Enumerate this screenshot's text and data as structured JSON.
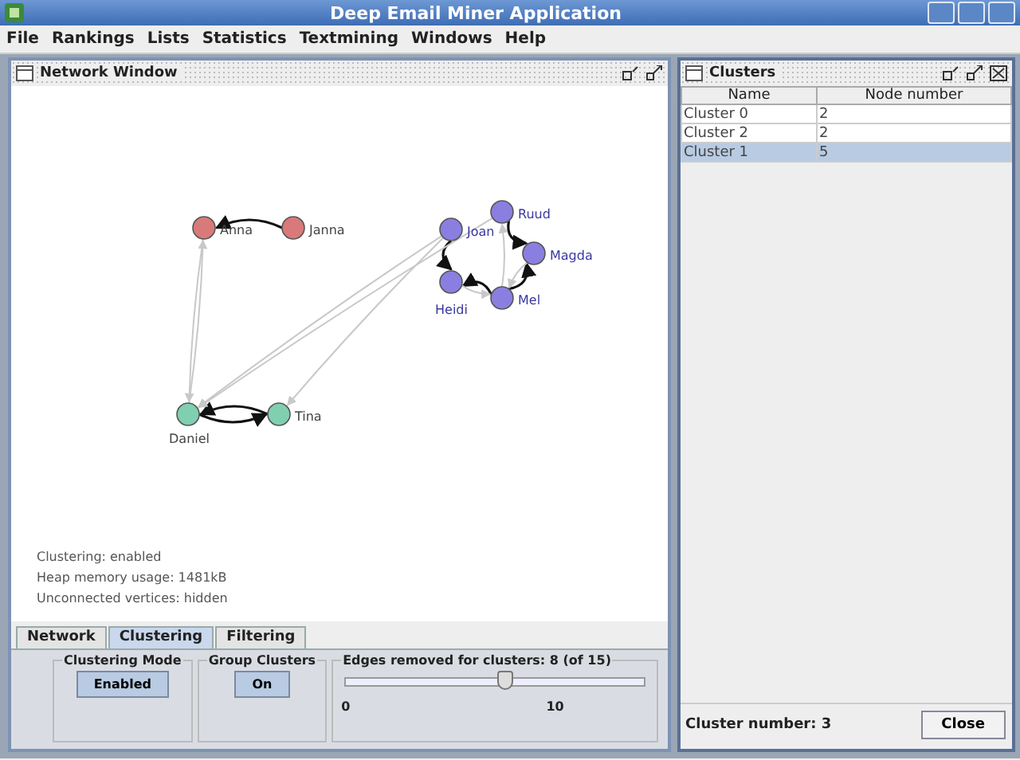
{
  "window": {
    "title": "Deep Email Miner Application"
  },
  "menu": [
    "File",
    "Rankings",
    "Lists",
    "Statistics",
    "Textmining",
    "Windows",
    "Help"
  ],
  "network_window": {
    "title": "Network Window",
    "nodes": [
      {
        "label": "Anna",
        "color": "#d97a7a"
      },
      {
        "label": "Janna",
        "color": "#d97a7a"
      },
      {
        "label": "Daniel",
        "color": "#7fcfb0"
      },
      {
        "label": "Tina",
        "color": "#7fcfb0"
      },
      {
        "label": "Joan",
        "color": "#8a7fe0"
      },
      {
        "label": "Ruud",
        "color": "#8a7fe0"
      },
      {
        "label": "Magda",
        "color": "#8a7fe0"
      },
      {
        "label": "Heidi",
        "color": "#8a7fe0"
      },
      {
        "label": "Mel",
        "color": "#8a7fe0"
      }
    ],
    "status": [
      "Clustering: enabled",
      "Heap memory usage: 1481kB",
      "Unconnected vertices: hidden"
    ],
    "tabs": [
      {
        "label": "Network",
        "selected": false
      },
      {
        "label": "Clustering",
        "selected": true
      },
      {
        "label": "Filtering",
        "selected": false
      }
    ],
    "clustering_mode": {
      "title": "Clustering Mode",
      "button": "Enabled",
      "pressed": true
    },
    "group_clusters": {
      "title": "Group Clusters",
      "button": "On",
      "pressed": true
    },
    "edges_slider": {
      "title": "Edges removed for clusters: 8 (of 15)",
      "level": 0.533,
      "ticks": [
        "0",
        "10"
      ]
    }
  },
  "clusters_window": {
    "title": "Clusters",
    "columns": [
      "Name",
      "Node number"
    ],
    "rows": [
      {
        "cells": [
          "Cluster 0",
          "2"
        ],
        "selected": false
      },
      {
        "cells": [
          "Cluster 2",
          "2"
        ],
        "selected": false
      },
      {
        "cells": [
          "Cluster 1",
          "5"
        ],
        "selected": true
      }
    ],
    "footer": "Cluster number: 3",
    "close_button": "Close"
  }
}
